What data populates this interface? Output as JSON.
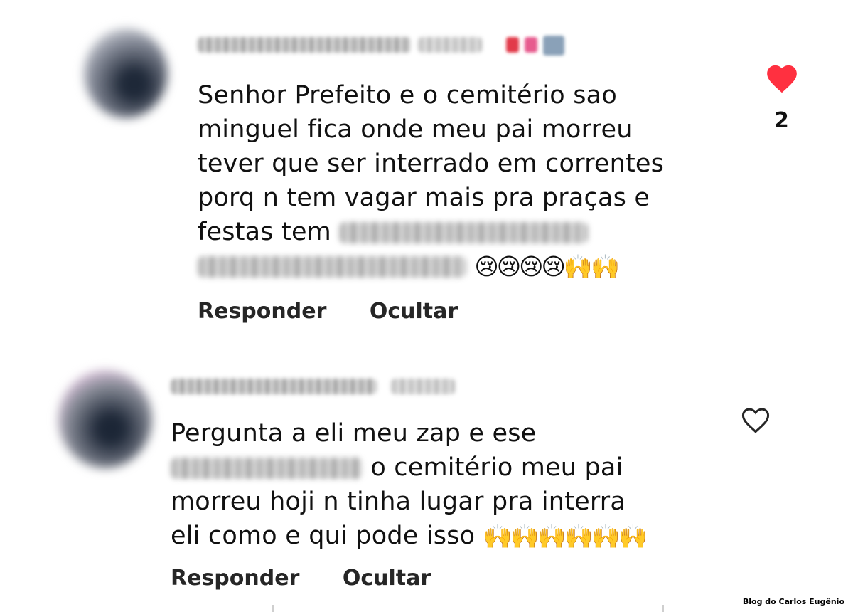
{
  "comments": [
    {
      "text_lines": [
        "Senhor Prefeito e o cemitério sao",
        "minguel fica onde meu pai morreu",
        "tever que ser interrado em correntes",
        "porq n tem vagar mais pra praças e",
        "festas tem"
      ],
      "text_end_emojis": "😢😢😢😢🙌🙌",
      "liked": true,
      "like_count": "2",
      "reply_label": "Responder",
      "hide_label": "Ocultar"
    },
    {
      "text_lines": [
        "Pergunta a eli meu zap e ese",
        "o cemitério meu pai",
        "morreu hoji n tinha lugar pra interra",
        "eli como e qui pode isso"
      ],
      "text_end_emojis": "🙌🙌🙌🙌🙌🙌",
      "liked": false,
      "reply_label": "Responder",
      "hide_label": "Ocultar"
    }
  ],
  "colors": {
    "heart_filled": "#ff3040",
    "heart_outline": "#262626",
    "text": "#111111",
    "action_text": "#262626"
  },
  "icons": {
    "like_filled": "heart-filled-icon",
    "like_outline": "heart-outline-icon"
  },
  "watermark": "Blog do Carlos Eugênio"
}
